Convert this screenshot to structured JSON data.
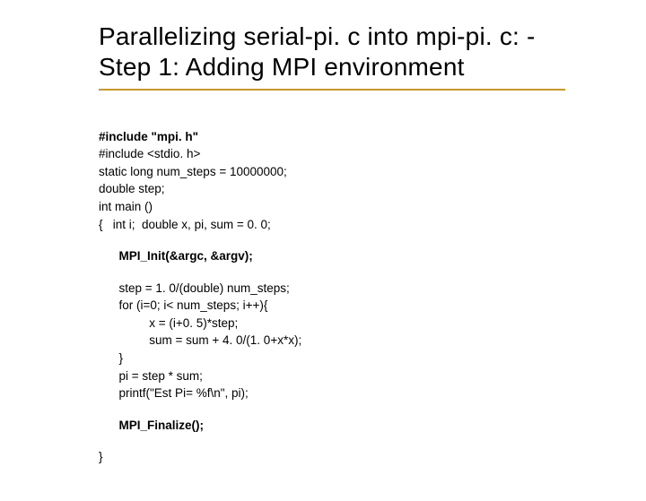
{
  "title_line1": "Parallelizing serial-pi. c into mpi-pi. c: -",
  "title_line2": "Step 1: Adding MPI environment",
  "code": {
    "b1_l1": "#include \"mpi. h\"",
    "b1_l2": "#include <stdio. h>",
    "b1_l3": "static long num_steps = 10000000;",
    "b1_l4": "double step;",
    "b1_l5": "int main ()",
    "b1_l6": "{   int i;  double x, pi, sum = 0. 0;",
    "b2_l1": "      MPI_Init(&argc, &argv);",
    "b3_l1": "      step = 1. 0/(double) num_steps;",
    "b3_l2": "      for (i=0; i< num_steps; i++){",
    "b3_l3": "               x = (i+0. 5)*step;",
    "b3_l4": "               sum = sum + 4. 0/(1. 0+x*x);",
    "b3_l5": "      }",
    "b3_l6": "      pi = step * sum;",
    "b3_l7": "      printf(\"Est Pi= %f\\n\", pi);",
    "b4_l1": "      MPI_Finalize();",
    "b5_l1": "}"
  }
}
